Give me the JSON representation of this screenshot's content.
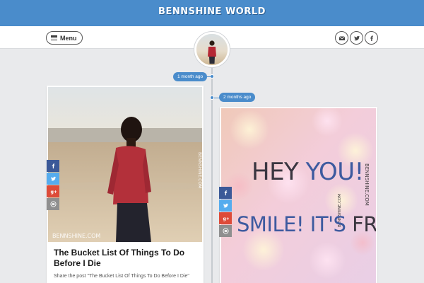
{
  "header": {
    "site_title": "BENNSHINE WORLD",
    "brand_color": "#4a8ccb"
  },
  "navbar": {
    "menu_label": "Menu",
    "social_icons": [
      "email-icon",
      "twitter-icon",
      "facebook-icon"
    ]
  },
  "timeline": {
    "dates": [
      "1 month ago",
      "2 months ago"
    ]
  },
  "posts": [
    {
      "image_watermark": "BENNSHINE.COM",
      "title": "The Bucket List Of Things To Do Before I Die",
      "excerpt": "Share the post \"The Bucket List Of Things To Do Before I Die\""
    },
    {
      "image_line1_a": "HEY ",
      "image_line1_b": "YOU!",
      "image_line2_a": "SMILE! IT'S ",
      "image_line2_b": "FREE!",
      "image_watermark": "BENNSHINE.COM"
    }
  ],
  "share_icons": [
    "facebook-icon",
    "twitter-icon",
    "google-plus-icon",
    "email-icon"
  ],
  "share_colors": [
    "#3b5998",
    "#55acee",
    "#dd4b39",
    "#8f8f8f"
  ]
}
